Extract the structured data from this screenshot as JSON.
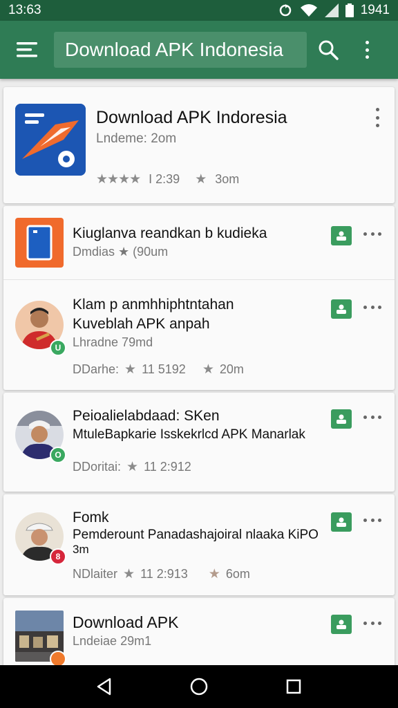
{
  "status": {
    "time_left": "13:63",
    "time_right": "1941",
    "icons": [
      "sync-icon",
      "wifi-icon",
      "signal-icon",
      "battery-icon"
    ]
  },
  "appbar": {
    "title": "Download APK Indonesia",
    "menu_icon": "menu-icon",
    "search_icon": "search-icon",
    "more_icon": "more-vert-icon"
  },
  "featured": {
    "title": "Download APK Indoresia",
    "subtitle": "Lndeme: 2om",
    "rating_text": "I  2:39",
    "stat_text": "3om"
  },
  "list": [
    {
      "title": "Kiuglanva reandkan b kudieka",
      "sub": "Dmdias ★ (90um",
      "meta": []
    },
    {
      "title": "Klam p anmhhiphtntahan",
      "title2": "Kuveblah APK anpah",
      "sub": "Lhradne 79md",
      "meta_left": "DDarhe:",
      "meta_mid": "11 5192",
      "meta_right": "20m",
      "badge": "U"
    },
    {
      "title": "Peioalielabdaad: SKen",
      "title2": "MtuleBapkarie Isskekrlcd APK Manarlak",
      "meta_left": "DDoritai:",
      "meta_mid": "11 2:912",
      "badge": "O"
    },
    {
      "title": "Fomk",
      "title2": "Pemderount Panadashajoiral nlaaka KiPO",
      "title3": "3m",
      "meta_left": "NDlaiter",
      "meta_mid": "11 2:913",
      "meta_right": "6om",
      "badge": "8"
    },
    {
      "title": "Download APK",
      "sub": "Lndeiae 29m1"
    }
  ],
  "colors": {
    "status_bar": "#1e5e3c",
    "app_bar": "#2f7c55",
    "install": "#3a9c5e",
    "nav_bar": "#000000"
  },
  "nav": [
    "back-icon",
    "home-icon",
    "recents-icon"
  ]
}
